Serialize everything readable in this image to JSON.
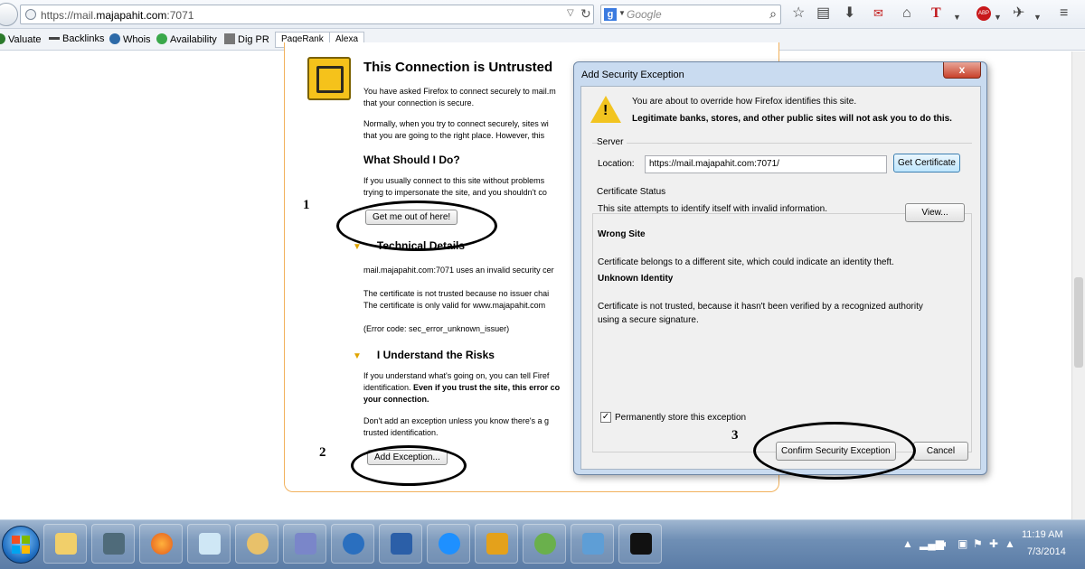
{
  "browser": {
    "url_prefix": "https://mail.",
    "url_host": "majapahit.com",
    "url_suffix": ":7071",
    "search_placeholder": "Google"
  },
  "bookmarks": [
    {
      "label": "Valuate",
      "icon": "valuate-icon"
    },
    {
      "label": "Backlinks",
      "icon": "backlinks-icon"
    },
    {
      "label": "Whois",
      "icon": "whois-icon"
    },
    {
      "label": "Availability",
      "icon": "availability-icon"
    },
    {
      "label": "Dig PR",
      "icon": "digpr-icon"
    },
    {
      "label": "PageRank",
      "icon": "pagerank-tab"
    },
    {
      "label": "Alexa",
      "icon": "alexa-tab"
    }
  ],
  "error_page": {
    "title": "This Connection is Untrusted",
    "intro_line1": "You have asked Firefox to connect securely to mail.m",
    "intro_line2": "that your connection is secure.",
    "normal_line1": "Normally, when you try to connect securely, sites wi",
    "normal_line2": "that you are going to the right place. However, this",
    "what_heading": "What Should I Do?",
    "what_line1": "If you usually connect to this site without problems",
    "what_line2": "trying to impersonate the site, and you shouldn't co",
    "get_out_button": "Get me out of here!",
    "tech_heading": "Technical Details",
    "tech_line1": "mail.majapahit.com:7071 uses an invalid security cer",
    "tech_line2": "The certificate is not trusted because no issuer chai",
    "tech_line3": "The certificate is only valid for www.majapahit.com",
    "error_code": "(Error code: sec_error_unknown_issuer)",
    "risks_heading": "I Understand the Risks",
    "risks_line1": "If you understand what's going on, you can tell Firef",
    "risks_line2_a": "identification. ",
    "risks_line2_b": "Even if you trust the site, this error co",
    "risks_line3": "your connection.",
    "dont_line1": "Don't add an exception unless you know there's a g",
    "dont_line2": "trusted identification.",
    "add_exception_button": "Add Exception..."
  },
  "annotations": {
    "one": "1",
    "two": "2",
    "three": "3"
  },
  "dialog": {
    "title": "Add Security Exception",
    "close_label": "x",
    "warning_line1": "You are about to override how Firefox identifies this site.",
    "warning_line2": "Legitimate banks, stores, and other public sites will not ask you to do this.",
    "server_legend": "Server",
    "location_label": "Location:",
    "location_value": "https://mail.majapahit.com:7071/",
    "get_certificate_button": "Get Certificate",
    "status_legend": "Certificate Status",
    "status_text": "This site attempts to identify itself with invalid information.",
    "view_button": "View...",
    "wrong_site_heading": "Wrong Site",
    "wrong_site_text": "Certificate belongs to a different site, which could indicate an identity theft.",
    "unknown_identity_heading": "Unknown Identity",
    "unknown_line1": "Certificate is not trusted, because it hasn't been verified by a recognized authority",
    "unknown_line2": "using a secure signature.",
    "permanent_label": "Permanently store this exception",
    "permanent_checked": true,
    "confirm_button": "Confirm Security Exception",
    "cancel_button": "Cancel"
  },
  "taskbar": {
    "time": "11:19 AM",
    "date": "7/3/2014",
    "apps": [
      "file-explorer-icon",
      "network-icon",
      "firefox-icon",
      "notepad-icon",
      "paint-icon",
      "remote-desktop-icon",
      "browser-icon",
      "sniffing-tool-icon",
      "media-player-icon",
      "virtualbox-icon",
      "chat-icon",
      "control-panel-icon",
      "cmd-icon"
    ]
  },
  "colors": {
    "error_border": "#f1b15c",
    "warning_yellow": "#f2c420",
    "dialog_frame": "#c9dbf0"
  }
}
